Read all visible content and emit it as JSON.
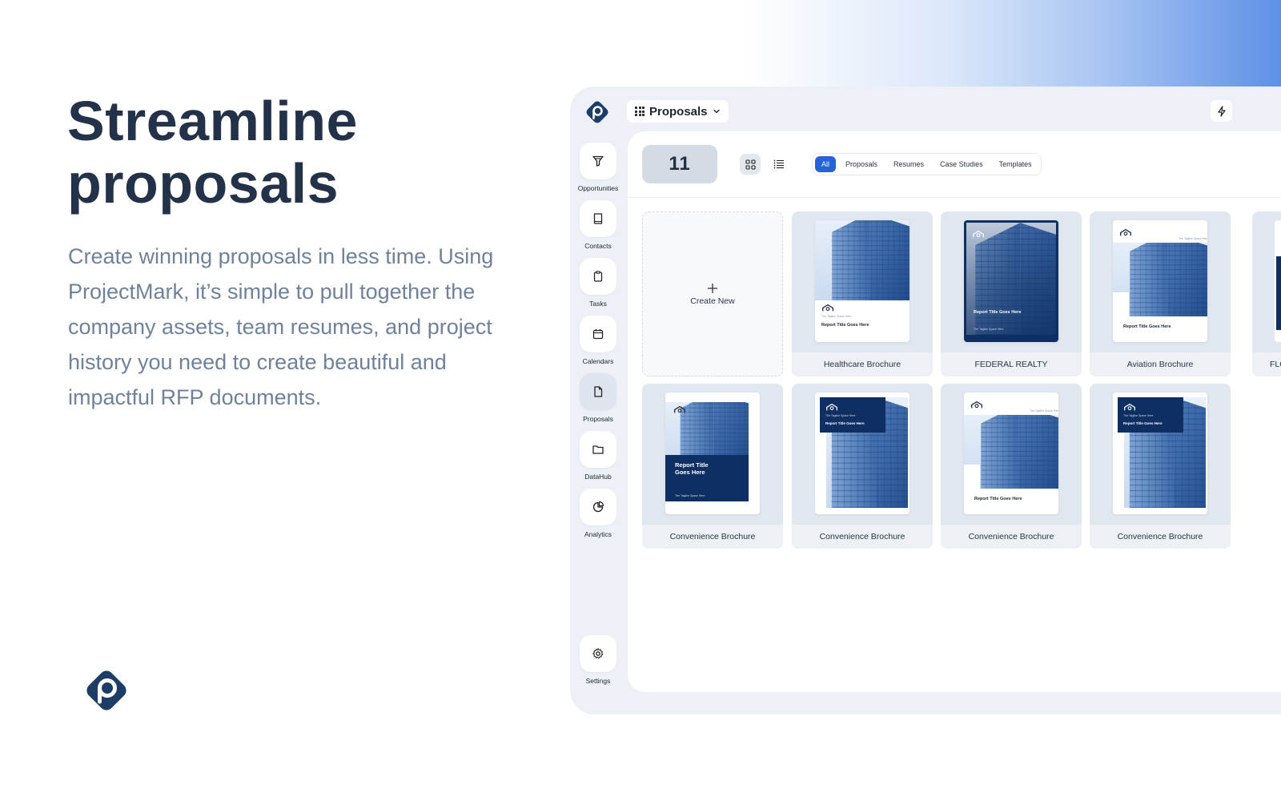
{
  "hero": {
    "title_line1": "Streamline",
    "title_line2": "proposals",
    "body": "Create winning proposals in less time. Using ProjectMark,  it’s simple to pull together the company assets, team resumes, and project history you need to create beautiful and impactful RFP documents."
  },
  "colors": {
    "brand": "#1d3c66",
    "accent": "#2563d9",
    "heading": "#233249",
    "body": "#6f819b"
  },
  "app": {
    "switcher_label": "Proposals",
    "switcher_icon": "grid-icon",
    "quick_action_icon": "bolt-icon"
  },
  "sidebar": {
    "items": [
      {
        "label": "Opportunities",
        "icon": "funnel-icon"
      },
      {
        "label": "Contacts",
        "icon": "book-icon"
      },
      {
        "label": "Tasks",
        "icon": "clipboard-icon"
      },
      {
        "label": "Calendars",
        "icon": "calendar-icon"
      },
      {
        "label": "Proposals",
        "icon": "document-icon",
        "active": true
      },
      {
        "label": "DataHub",
        "icon": "folder-icon"
      },
      {
        "label": "Analytics",
        "icon": "pie-chart-icon"
      }
    ],
    "settings": {
      "label": "Settings",
      "icon": "gear-icon"
    }
  },
  "toolbar": {
    "count": "11",
    "filters": [
      "All",
      "Proposals",
      "Resumes",
      "Case Studies",
      "Templates"
    ],
    "active_filter": "All"
  },
  "grid": {
    "create_label": "Create New",
    "cards": [
      {
        "label": "Healthcare Brochure",
        "doc_title": "Report Title Goes Here"
      },
      {
        "label": "FEDERAL REALTY",
        "doc_title": "Report Title Goes Here"
      },
      {
        "label": "Aviation Brochure",
        "doc_title": "Report Title Goes Here"
      },
      {
        "label": "FLC"
      },
      {
        "label": "Convenience Brochure",
        "doc_title_line1": "Report Title",
        "doc_title_line2": "Goes Here"
      },
      {
        "label": "Convenience Brochure",
        "doc_title": "Report Title Goes Here"
      },
      {
        "label": "Convenience Brochure",
        "doc_title": "Report Title Goes Here"
      },
      {
        "label": "Convenience Brochure",
        "doc_title": "Report Title Goes Here"
      }
    ]
  }
}
